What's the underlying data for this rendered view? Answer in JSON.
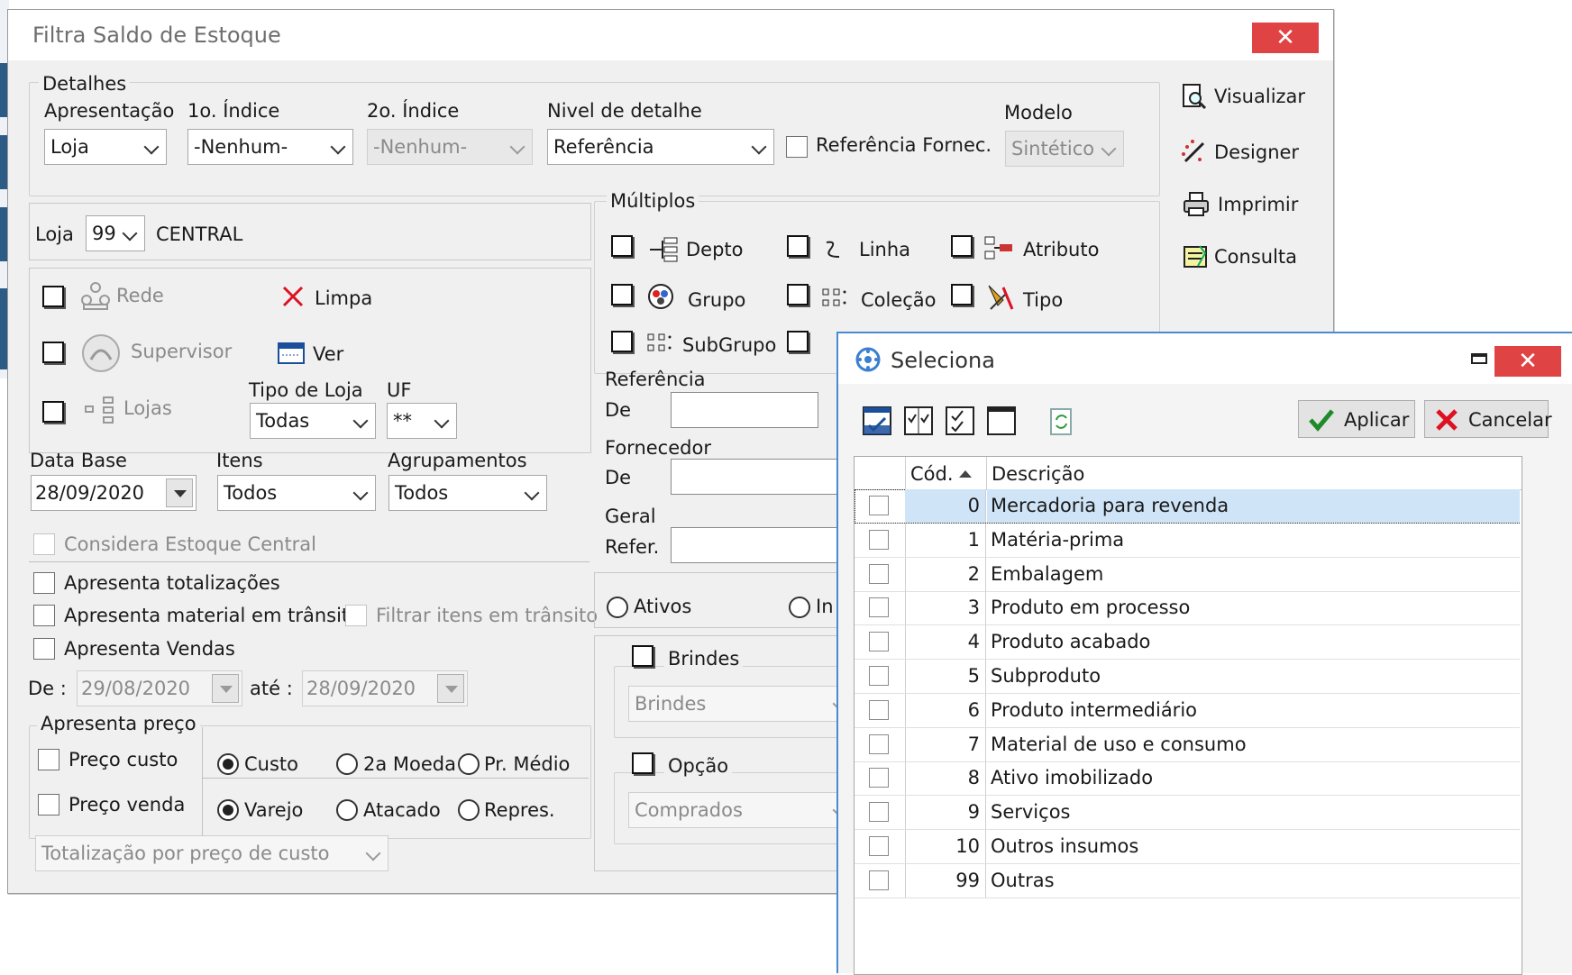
{
  "window": {
    "title": "Filtra Saldo de Estoque"
  },
  "detalhes": {
    "legend": "Detalhes",
    "apresentacao_label": "Apresentação",
    "apresentacao_value": "Loja",
    "indice1_label": "1o. Índice",
    "indice1_value": "-Nenhum-",
    "indice2_label": "2o. Índice",
    "indice2_value": "-Nenhum-",
    "nivel_label": "Nivel de detalhe",
    "nivel_value": "Referência",
    "ref_fornec_label": "Referência Fornec.",
    "modelo_label": "Modelo",
    "modelo_value": "Sintético"
  },
  "actions": {
    "visualizar": "Visualizar",
    "designer": "Designer",
    "imprimir": "Imprimir",
    "consulta": "Consulta"
  },
  "loja": {
    "label": "Loja",
    "value": "99",
    "name": "CENTRAL"
  },
  "filters": {
    "rede": "Rede",
    "supervisor": "Supervisor",
    "lojas": "Lojas",
    "limpa": "Limpa",
    "ver": "Ver",
    "tipo_loja_label": "Tipo de Loja",
    "tipo_loja_value": "Todas",
    "uf_label": "UF",
    "uf_value": "**"
  },
  "data_base": {
    "label": "Data Base",
    "value": "28/09/2020"
  },
  "itens": {
    "label": "Itens",
    "value": "Todos"
  },
  "agrupamentos": {
    "label": "Agrupamentos",
    "value": "Todos"
  },
  "options": {
    "considera_estoque_central": "Considera Estoque Central",
    "apresenta_totalizacoes": "Apresenta totalizações",
    "apresenta_transito": "Apresenta material em trânsito",
    "filtrar_transito": "Filtrar itens em trânsito",
    "apresenta_vendas": "Apresenta Vendas",
    "de_label": "De :",
    "de_value": "29/08/2020",
    "ate_label": "até :",
    "ate_value": "28/09/2020"
  },
  "preco": {
    "legend": "Apresenta preço",
    "custo_cb": "Preço custo",
    "venda_cb": "Preço venda",
    "r_custo": "Custo",
    "r_2a_moeda": "2a Moeda",
    "r_pr_medio": "Pr. Médio",
    "r_varejo": "Varejo",
    "r_atacado": "Atacado",
    "r_repres": "Repres.",
    "totalizacao": "Totalização por preço de custo"
  },
  "multiplos": {
    "legend": "Múltiplos",
    "depto": "Depto",
    "linha": "Linha",
    "atributo": "Atributo",
    "grupo": "Grupo",
    "colecao": "Coleção",
    "tipo": "Tipo",
    "subgrupo": "SubGrupo"
  },
  "referencia": {
    "legend": "Referência",
    "de": "De"
  },
  "fornecedor": {
    "legend": "Fornecedor",
    "de": "De"
  },
  "geral": {
    "legend": "Geral",
    "refer": "Refer."
  },
  "status": {
    "ativos": "Ativos",
    "inativos_partial": "In"
  },
  "brindes": {
    "label": "Brindes",
    "value": "Brindes"
  },
  "opcao": {
    "label": "Opção",
    "value": "Comprados"
  },
  "popup": {
    "title": "Seleciona",
    "aplicar": "Aplicar",
    "cancelar": "Cancelar",
    "col_cod": "Cód.",
    "col_desc": "Descrição",
    "rows": [
      {
        "cod": "0",
        "desc": "Mercadoria para revenda"
      },
      {
        "cod": "1",
        "desc": "Matéria-prima"
      },
      {
        "cod": "2",
        "desc": "Embalagem"
      },
      {
        "cod": "3",
        "desc": "Produto em processo"
      },
      {
        "cod": "4",
        "desc": "Produto acabado"
      },
      {
        "cod": "5",
        "desc": "Subproduto"
      },
      {
        "cod": "6",
        "desc": "Produto intermediário"
      },
      {
        "cod": "7",
        "desc": "Material de uso e consumo"
      },
      {
        "cod": "8",
        "desc": "Ativo imobilizado"
      },
      {
        "cod": "9",
        "desc": "Serviços"
      },
      {
        "cod": "10",
        "desc": "Outros insumos"
      },
      {
        "cod": "99",
        "desc": "Outras"
      }
    ]
  },
  "colors": {
    "close": "#e04343",
    "selection": "#cfe4f7",
    "accent": "#2c5b86"
  }
}
